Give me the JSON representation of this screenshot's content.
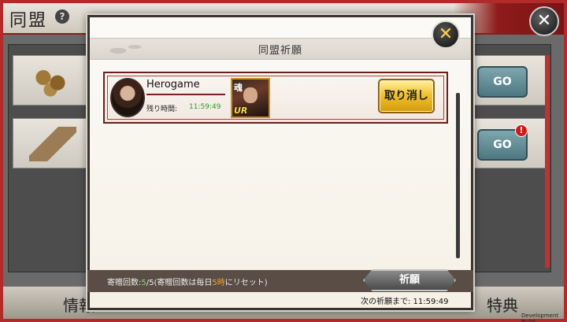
{
  "background": {
    "title": "同盟",
    "help_symbol": "?",
    "close_symbol": "✕",
    "go_buttons": [
      "GO",
      "GO"
    ],
    "badge_symbol": "!",
    "tab_left": "情報",
    "tab_right": "特典",
    "dev_build": "Development Build"
  },
  "dialog": {
    "title": "同盟祈願",
    "close_symbol": "✕",
    "request": {
      "player_name": "Herogame",
      "remaining_label": "残り時間:",
      "remaining_time": "11:59:49",
      "item_kanji": "魂",
      "item_rarity": "UR",
      "cancel_label": "取り消し"
    },
    "footer": {
      "gift_prefix": "寄贈回数:",
      "gift_used": "5",
      "gift_total": "/5(寄贈回数は毎日",
      "reset_hour": "5時",
      "reset_suffix": "にリセット)",
      "pray_label": "祈願",
      "next_label": "次の祈願まで: 11:59:49"
    }
  },
  "colors": {
    "frame_red": "#b22a2a",
    "timer_green": "#2a9c2a",
    "cancel_gold": "#f0c232",
    "footer_brown": "#5a4d45"
  }
}
